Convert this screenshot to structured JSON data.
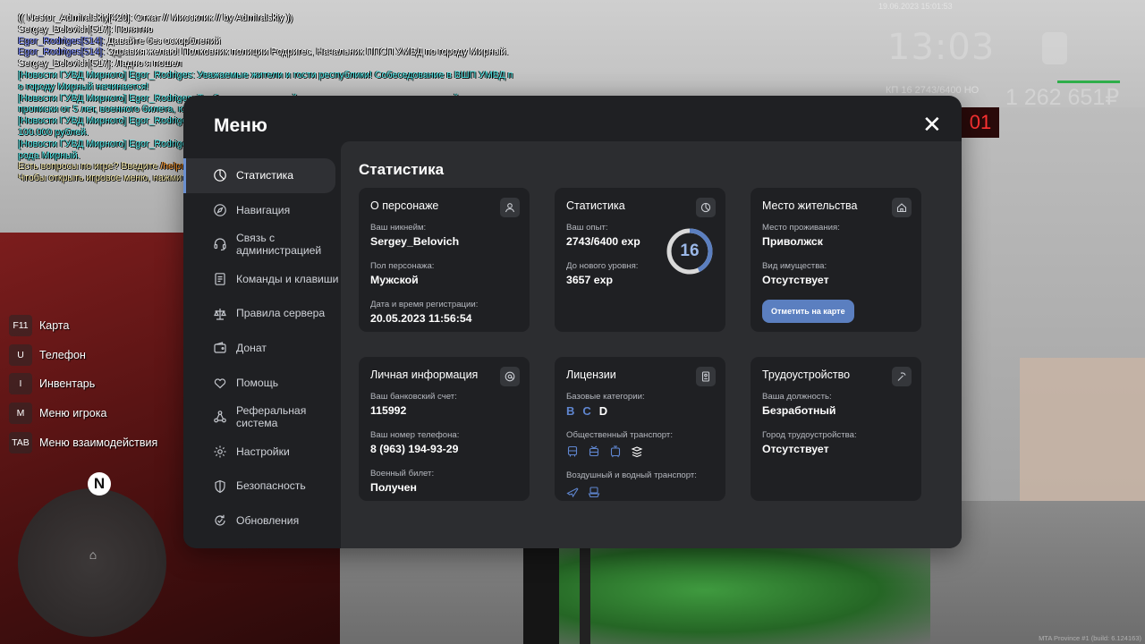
{
  "chat": [
    {
      "parts": [
        {
          "text": "(( Nestor_Admiralskiy[420]: Откат // Миссклик // by Admiralskiy ))",
          "color": "white"
        }
      ]
    },
    {
      "parts": [
        {
          "text": "Sergey_Belovich[517]: Понятно",
          "color": "white"
        }
      ]
    },
    {
      "parts": [
        {
          "text": "Egor_Rodriges[514]:",
          "color": "blue"
        },
        {
          "text": " Давайте без оскорблений",
          "color": "white"
        }
      ]
    },
    {
      "parts": [
        {
          "text": "Egor_Rodriges[514]:",
          "color": "blue"
        },
        {
          "text": " Здравия желаю! Полковник полиции Родригес, Начальник ППСП УМВД по городу Мирный.",
          "color": "white"
        }
      ]
    },
    {
      "parts": [
        {
          "text": "Sergey_Belovich[517]: Ладно я пошел",
          "color": "white"
        }
      ]
    },
    {
      "parts": [
        {
          "text": "[Новости ГУВД Мирного] Egor_Rodriges: Уважаемые жители и гости республики! Собеседование в ВШП УМВД п",
          "color": "cyan"
        }
      ]
    },
    {
      "parts": [
        {
          "text": "о городу Мирный начинается!",
          "color": "cyan"
        }
      ]
    },
    {
      "parts": [
        {
          "text": "[Новости ГУВД Мирного] Egor_Rodriges: Требования: опрятный вид, наличие: паспорта, актуальной мед.карты,",
          "color": "cyan"
        }
      ]
    },
    {
      "parts": [
        {
          "text": " прописки от 5 лет, военного билета, юридического образования.",
          "color": "cyan"
        }
      ]
    },
    {
      "parts": [
        {
          "text": "[Новости ГУВД Мирного] Egor_Rodriges: После успешного окончания обучения курсант получает премию до",
          "color": "cyan"
        }
      ]
    },
    {
      "parts": [
        {
          "text": " 100.000 рублей.",
          "color": "cyan"
        }
      ]
    },
    {
      "parts": [
        {
          "text": "[Новости ГУВД Мирного] Egor_Rodriges: Собеседование будет проходить на парковке полицейского участка го",
          "color": "cyan"
        }
      ]
    },
    {
      "parts": [
        {
          "text": "рода Мирный.",
          "color": "cyan"
        }
      ]
    },
    {
      "parts": [
        {
          "text": "Есть вопросы по игре? Введите ",
          "color": "yellow"
        },
        {
          "text": "/helpme",
          "color": "orange"
        },
        {
          "text": " чтобы получить нужную информацию.",
          "color": "yellow"
        }
      ]
    },
    {
      "parts": [
        {
          "text": "Чтобы открыть игровое меню, нажмите \"M\".",
          "color": "yellow"
        }
      ]
    }
  ],
  "hud": {
    "date": "19.06.2023 15:01:53",
    "time": "13:03",
    "level_text": "КП 16 2743/6400 НО",
    "money": "1 262 651₽",
    "red_digits": "01"
  },
  "keybinds": [
    {
      "key": "F11",
      "label": "Карта"
    },
    {
      "key": "U",
      "label": "Телефон"
    },
    {
      "key": "I",
      "label": "Инвентарь"
    },
    {
      "key": "M",
      "label": "Меню игрока"
    },
    {
      "key": "TAB",
      "label": "Меню взаимодействия"
    }
  ],
  "radar": {
    "north": "N"
  },
  "menu": {
    "title": "Меню",
    "close": "✕",
    "nav": [
      {
        "label": "Статистика",
        "icon": "pie-chart-icon",
        "active": true
      },
      {
        "label": "Навигация",
        "icon": "compass-icon",
        "active": false
      },
      {
        "label": "Связь с администрацией",
        "icon": "headset-icon",
        "active": false
      },
      {
        "label": "Команды и клавиши",
        "icon": "document-icon",
        "active": false
      },
      {
        "label": "Правила сервера",
        "icon": "scales-icon",
        "active": false
      },
      {
        "label": "Донат",
        "icon": "wallet-icon",
        "active": false
      },
      {
        "label": "Помощь",
        "icon": "heart-hands-icon",
        "active": false
      },
      {
        "label": "Реферальная система",
        "icon": "network-icon",
        "active": false
      },
      {
        "label": "Настройки",
        "icon": "gear-icon",
        "active": false
      },
      {
        "label": "Безопасность",
        "icon": "shield-icon",
        "active": false
      },
      {
        "label": "Обновления",
        "icon": "refresh-icon",
        "active": false
      }
    ]
  },
  "stats": {
    "title": "Статистика",
    "character": {
      "title": "О персонаже",
      "icon": "user-icon",
      "nickname_label": "Ваш никнейм:",
      "nickname": "Sergey_Belovich",
      "gender_label": "Пол персонажа:",
      "gender": "Мужской",
      "reg_label": "Дата и время регистрации:",
      "reg": "20.05.2023 11:56:54"
    },
    "statistics": {
      "title": "Статистика",
      "icon": "clock-pie-icon",
      "exp_label": "Ваш опыт:",
      "exp": "2743/6400 exp",
      "next_label": "До нового уровня:",
      "next": "3657 exp",
      "level": "16",
      "progress": 0.4286
    },
    "residence": {
      "title": "Место жительства",
      "icon": "house-icon",
      "place_label": "Место проживания:",
      "place": "Приволжск",
      "property_label": "Вид имущества:",
      "property": "Отсутствует",
      "button": "Отметить на карте"
    },
    "personal": {
      "title": "Личная информация",
      "icon": "at-icon",
      "bank_label": "Ваш банковский счет:",
      "bank": "115992",
      "phone_label": "Ваш номер телефона:",
      "phone": "8 (963) 194-93-29",
      "military_label": "Военный билет:",
      "military": "Получен"
    },
    "licenses": {
      "title": "Лицензии",
      "icon": "id-card-icon",
      "base_label": "Базовые категории:",
      "categories": [
        {
          "name": "B",
          "held": false
        },
        {
          "name": "C",
          "held": false
        },
        {
          "name": "D",
          "held": true
        }
      ],
      "public_label": "Общественный транспорт:",
      "public_icons": [
        "bus-icon",
        "trolleybus-icon",
        "tram-icon",
        "subway-icon"
      ],
      "air_label": "Воздушный и водный транспорт:",
      "air_icons": [
        "plane-icon",
        "boat-icon"
      ]
    },
    "employment": {
      "title": "Трудоустройство",
      "icon": "pickaxe-icon",
      "position_label": "Ваша должность:",
      "position": "Безработный",
      "city_label": "Город трудоустройства:",
      "city": "Отсутствует"
    }
  },
  "build": "MTA Province #1 (build: 6.124163)",
  "colors": {
    "accent": "#5b7fc0",
    "chat_cyan": "#4fe8e8",
    "chat_blue": "#7b8cff",
    "chat_yellow": "#f1e6a8",
    "chat_orange": "#ff9a2e"
  }
}
